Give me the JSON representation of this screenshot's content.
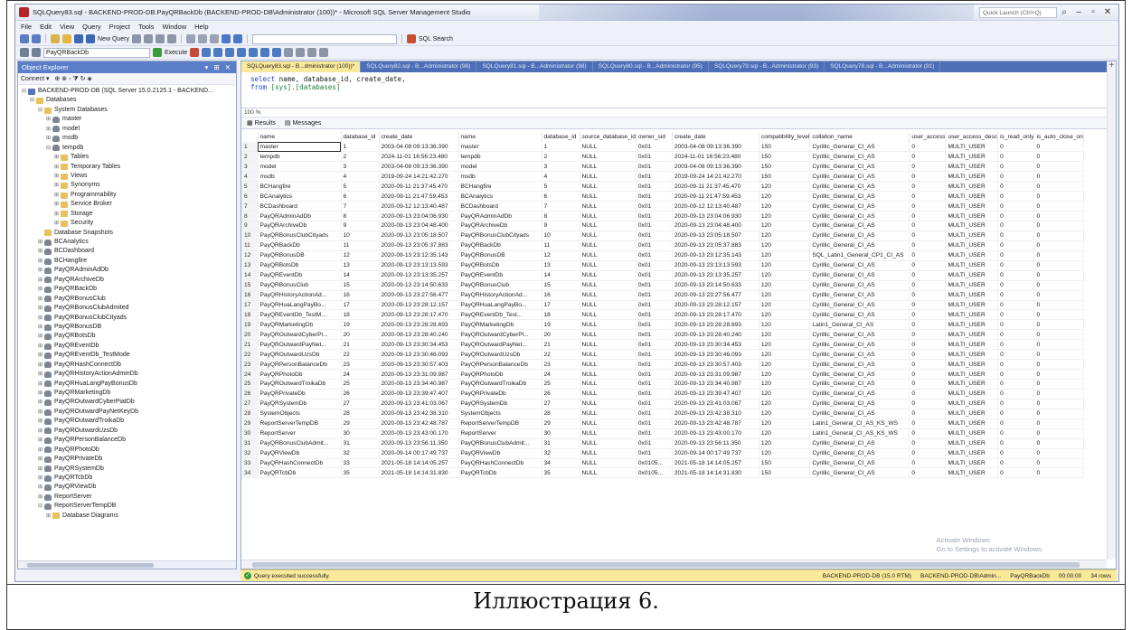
{
  "window": {
    "title": "SQLQuery83.sql - BACKEND-PROD-DB.PayQRBackDb (BACKEND-PROD-DB\\Administrator (100))* - Microsoft SQL Server Management Studio",
    "quick_launch": "Quick Launch (Ctrl+Q)"
  },
  "menu": [
    "File",
    "Edit",
    "View",
    "Query",
    "Project",
    "Tools",
    "Window",
    "Help"
  ],
  "toolbar": {
    "new_query": "New Query",
    "database": "PayQRBackDb",
    "execute": "Execute",
    "sql_search": "SQL Search"
  },
  "explorer": {
    "title": "Object Explorer",
    "connect": "Connect ▾",
    "items": [
      {
        "indent": 0,
        "toggle": "⊟",
        "icon": "server",
        "label": "BACKEND-PROD-DB (SQL Server 15.0.2125.1 - BACKEND..."
      },
      {
        "indent": 1,
        "toggle": "⊟",
        "icon": "folder",
        "label": "Databases"
      },
      {
        "indent": 2,
        "toggle": "⊟",
        "icon": "folder",
        "label": "System Databases"
      },
      {
        "indent": 3,
        "toggle": "⊞",
        "icon": "db",
        "label": "master"
      },
      {
        "indent": 3,
        "toggle": "⊞",
        "icon": "db",
        "label": "model"
      },
      {
        "indent": 3,
        "toggle": "⊞",
        "icon": "db",
        "label": "msdb"
      },
      {
        "indent": 3,
        "toggle": "⊟",
        "icon": "db",
        "label": "tempdb"
      },
      {
        "indent": 4,
        "toggle": "⊞",
        "icon": "folder",
        "label": "Tables"
      },
      {
        "indent": 4,
        "toggle": "⊞",
        "icon": "folder",
        "label": "Temporary Tables"
      },
      {
        "indent": 4,
        "toggle": "⊞",
        "icon": "folder",
        "label": "Views"
      },
      {
        "indent": 4,
        "toggle": "⊞",
        "icon": "folder",
        "label": "Synonyms"
      },
      {
        "indent": 4,
        "toggle": "⊞",
        "icon": "folder",
        "label": "Programmability"
      },
      {
        "indent": 4,
        "toggle": "⊞",
        "icon": "folder",
        "label": "Service Broker"
      },
      {
        "indent": 4,
        "toggle": "⊞",
        "icon": "folder",
        "label": "Storage"
      },
      {
        "indent": 4,
        "toggle": "⊞",
        "icon": "folder",
        "label": "Security"
      },
      {
        "indent": 2,
        "toggle": "",
        "icon": "folder",
        "label": "Database Snapshots"
      },
      {
        "indent": 2,
        "toggle": "⊞",
        "icon": "db",
        "label": "BCAnalytics"
      },
      {
        "indent": 2,
        "toggle": "⊞",
        "icon": "db",
        "label": "BCDashboard"
      },
      {
        "indent": 2,
        "toggle": "⊞",
        "icon": "db",
        "label": "BCHangfire"
      },
      {
        "indent": 2,
        "toggle": "⊞",
        "icon": "db",
        "label": "PayQRAdminAdDb"
      },
      {
        "indent": 2,
        "toggle": "⊞",
        "icon": "db",
        "label": "PayQRArchiveDb"
      },
      {
        "indent": 2,
        "toggle": "⊞",
        "icon": "db",
        "label": "PayQRBackDb"
      },
      {
        "indent": 2,
        "toggle": "⊞",
        "icon": "db",
        "label": "PayQRBonusClub"
      },
      {
        "indent": 2,
        "toggle": "⊞",
        "icon": "db",
        "label": "PayQRBonusClubAdmited"
      },
      {
        "indent": 2,
        "toggle": "⊞",
        "icon": "db",
        "label": "PayQRBonusClubCityads"
      },
      {
        "indent": 2,
        "toggle": "⊞",
        "icon": "db",
        "label": "PayQRBonusDB"
      },
      {
        "indent": 2,
        "toggle": "⊞",
        "icon": "db",
        "label": "PayQRBotsDb"
      },
      {
        "indent": 2,
        "toggle": "⊞",
        "icon": "db",
        "label": "PayQREventDb"
      },
      {
        "indent": 2,
        "toggle": "⊞",
        "icon": "db",
        "label": "PayQREventDb_TestMode"
      },
      {
        "indent": 2,
        "toggle": "⊞",
        "icon": "db",
        "label": "PayQRHashConnectDb"
      },
      {
        "indent": 2,
        "toggle": "⊞",
        "icon": "db",
        "label": "PayQRHistoryActionAdminDb"
      },
      {
        "indent": 2,
        "toggle": "⊞",
        "icon": "db",
        "label": "PayQRHuaLangPayBonusDb"
      },
      {
        "indent": 2,
        "toggle": "⊞",
        "icon": "db",
        "label": "PayQRMarketingDb"
      },
      {
        "indent": 2,
        "toggle": "⊞",
        "icon": "db",
        "label": "PayQROutwardCyberPiatDb"
      },
      {
        "indent": 2,
        "toggle": "⊞",
        "icon": "db",
        "label": "PayQROutwardPayNetKeyDb"
      },
      {
        "indent": 2,
        "toggle": "⊞",
        "icon": "db",
        "label": "PayQROutwardTroikaDb"
      },
      {
        "indent": 2,
        "toggle": "⊞",
        "icon": "db",
        "label": "PayQROutwardUzsDb"
      },
      {
        "indent": 2,
        "toggle": "⊞",
        "icon": "db",
        "label": "PayQRPersonBalanceDb"
      },
      {
        "indent": 2,
        "toggle": "⊞",
        "icon": "db",
        "label": "PayQRPhotoDb"
      },
      {
        "indent": 2,
        "toggle": "⊞",
        "icon": "db",
        "label": "PayQRPrivateDb"
      },
      {
        "indent": 2,
        "toggle": "⊞",
        "icon": "db",
        "label": "PayQRSystemDb"
      },
      {
        "indent": 2,
        "toggle": "⊞",
        "icon": "db",
        "label": "PayQRTcbDb"
      },
      {
        "indent": 2,
        "toggle": "⊞",
        "icon": "db",
        "label": "PayQRViewDb"
      },
      {
        "indent": 2,
        "toggle": "⊞",
        "icon": "db",
        "label": "ReportServer"
      },
      {
        "indent": 2,
        "toggle": "⊟",
        "icon": "db",
        "label": "ReportServerTempDB"
      },
      {
        "indent": 3,
        "toggle": "⊞",
        "icon": "folder",
        "label": "Database Diagrams"
      }
    ]
  },
  "editor": {
    "tabs": [
      "SQLQuery83.sql - B...dministrator (100))*",
      "SQLQuery82.sql - B...Administrator (98)",
      "SQLQuery81.sql - B...Administrator (98)",
      "SQLQuery80.sql - B...Administrator (95)",
      "SQLQuery79.sql - B...Administrator (93)",
      "SQLQuery78.sql - B...Administrator (91)"
    ],
    "code_line1_kw": "select",
    "code_line1_rest": " name, database_id, create_date,",
    "code_line2_kw": "from",
    "code_line2_rest": "[sys].[databases]",
    "zoom": "100 %",
    "results_tab": "Results",
    "messages_tab": "Messages"
  },
  "grid": {
    "columns": [
      "",
      "name",
      "database_id",
      "create_date",
      "name",
      "database_id",
      "source_database_id",
      "owner_sid",
      "create_date",
      "compatibility_level",
      "collation_name",
      "user_access",
      "user_access_desc",
      "is_read_only",
      "is_auto_close_on"
    ],
    "rows": [
      [
        "1",
        "master",
        "1",
        "2003-04-08 09:13:36.390",
        "master",
        "1",
        "NULL",
        "0x01",
        "2003-04-08 09:13:36.390",
        "150",
        "Cyrillic_General_CI_AS",
        "0",
        "MULTI_USER",
        "0",
        "0"
      ],
      [
        "2",
        "tempdb",
        "2",
        "2024-11-01 16:56:23.480",
        "tempdb",
        "2",
        "NULL",
        "0x01",
        "2024-11-01 16:56:23.480",
        "150",
        "Cyrillic_General_CI_AS",
        "0",
        "MULTI_USER",
        "0",
        "0"
      ],
      [
        "3",
        "model",
        "3",
        "2003-04-08 09:13:36.390",
        "model",
        "3",
        "NULL",
        "0x01",
        "2003-04-08 09:13:36.390",
        "150",
        "Cyrillic_General_CI_AS",
        "0",
        "MULTI_USER",
        "0",
        "0"
      ],
      [
        "4",
        "msdb",
        "4",
        "2019-09-24 14:21:42.270",
        "msdb",
        "4",
        "NULL",
        "0x01",
        "2019-09-24 14:21:42.270",
        "150",
        "Cyrillic_General_CI_AS",
        "0",
        "MULTI_USER",
        "0",
        "0"
      ],
      [
        "5",
        "BCHangfire",
        "5",
        "2020-09-11 21:37:45.470",
        "BCHangfire",
        "5",
        "NULL",
        "0x01",
        "2020-09-11 21:37:45.470",
        "120",
        "Cyrillic_General_CI_AS",
        "0",
        "MULTI_USER",
        "0",
        "0"
      ],
      [
        "6",
        "BCAnalytics",
        "6",
        "2020-09-11 21:47:59.453",
        "BCAnalytics",
        "6",
        "NULL",
        "0x01",
        "2020-09-11 21:47:59.453",
        "120",
        "Cyrillic_General_CI_AS",
        "0",
        "MULTI_USER",
        "0",
        "0"
      ],
      [
        "7",
        "BCDashboard",
        "7",
        "2020-09-12 12:13:40.487",
        "BCDashboard",
        "7",
        "NULL",
        "0x01",
        "2020-09-12 12:13:40.487",
        "120",
        "Cyrillic_General_CI_AS",
        "0",
        "MULTI_USER",
        "0",
        "0"
      ],
      [
        "8",
        "PayQRAdminAdDb",
        "8",
        "2020-09-13 23:04:06.930",
        "PayQRAdminAdDb",
        "8",
        "NULL",
        "0x01",
        "2020-09-13 23:04:06.930",
        "120",
        "Cyrillic_General_CI_AS",
        "0",
        "MULTI_USER",
        "0",
        "0"
      ],
      [
        "9",
        "PayQRArchiveDb",
        "9",
        "2020-09-13 23:04:48.400",
        "PayQRArchiveDb",
        "9",
        "NULL",
        "0x01",
        "2020-09-13 23:04:48.400",
        "120",
        "Cyrillic_General_CI_AS",
        "0",
        "MULTI_USER",
        "0",
        "0"
      ],
      [
        "10",
        "PayQRBonusClubCityads",
        "10",
        "2020-09-13 23:05:18.507",
        "PayQRBonusClubCityads",
        "10",
        "NULL",
        "0x01",
        "2020-09-13 23:05:18.507",
        "120",
        "Cyrillic_General_CI_AS",
        "0",
        "MULTI_USER",
        "0",
        "0"
      ],
      [
        "11",
        "PayQRBackDb",
        "11",
        "2020-09-13 23:05:37.883",
        "PayQRBackDb",
        "11",
        "NULL",
        "0x01",
        "2020-09-13 23:05:37.883",
        "120",
        "Cyrillic_General_CI_AS",
        "0",
        "MULTI_USER",
        "0",
        "0"
      ],
      [
        "12",
        "PayQRBonusDB",
        "12",
        "2020-09-13 23:12:35.143",
        "PayQRBonusDB",
        "12",
        "NULL",
        "0x01",
        "2020-09-13 23:12:35.143",
        "120",
        "SQL_Latin1_General_CP1_CI_AS",
        "0",
        "MULTI_USER",
        "0",
        "0"
      ],
      [
        "13",
        "PayQRBotsDb",
        "13",
        "2020-09-13 23:13:13.593",
        "PayQRBotsDb",
        "13",
        "NULL",
        "0x01",
        "2020-09-13 23:13:13.593",
        "120",
        "Cyrillic_General_CI_AS",
        "0",
        "MULTI_USER",
        "0",
        "0"
      ],
      [
        "14",
        "PayQREventDb",
        "14",
        "2020-09-13 23:13:35.257",
        "PayQREventDb",
        "14",
        "NULL",
        "0x01",
        "2020-09-13 23:13:35.257",
        "120",
        "Cyrillic_General_CI_AS",
        "0",
        "MULTI_USER",
        "0",
        "0"
      ],
      [
        "15",
        "PayQRBonusClub",
        "15",
        "2020-09-13 23:14:50.633",
        "PayQRBonusClub",
        "15",
        "NULL",
        "0x01",
        "2020-09-13 23:14:50.633",
        "120",
        "Cyrillic_General_CI_AS",
        "0",
        "MULTI_USER",
        "0",
        "0"
      ],
      [
        "16",
        "PayQRHistoryActionAd...",
        "16",
        "2020-09-13 23:27:56.477",
        "PayQRHistoryActionAd...",
        "16",
        "NULL",
        "0x01",
        "2020-09-13 23:27:56.477",
        "120",
        "Cyrillic_General_CI_AS",
        "0",
        "MULTI_USER",
        "0",
        "0"
      ],
      [
        "17",
        "PayQRHuaLangPayBo...",
        "17",
        "2020-09-13 23:28:12.157",
        "PayQRHuaLangPayBo...",
        "17",
        "NULL",
        "0x01",
        "2020-09-13 23:28:12.157",
        "120",
        "Cyrillic_General_CI_AS",
        "0",
        "MULTI_USER",
        "0",
        "0"
      ],
      [
        "18",
        "PayQREventDb_TestM...",
        "18",
        "2020-09-13 23:28:17.470",
        "PayQREventDb_Test...",
        "18",
        "NULL",
        "0x01",
        "2020-09-13 23:28:17.470",
        "120",
        "Cyrillic_General_CI_AS",
        "0",
        "MULTI_USER",
        "0",
        "0"
      ],
      [
        "19",
        "PayQRMarketingDb",
        "19",
        "2020-09-13 23:28:28.693",
        "PayQRMarketingDb",
        "19",
        "NULL",
        "0x01",
        "2020-09-13 23:28:28.693",
        "120",
        "Latin1_General_CI_AS",
        "0",
        "MULTI_USER",
        "0",
        "0"
      ],
      [
        "20",
        "PayQROutwardCyberPl...",
        "20",
        "2020-09-13 23:28:40.240",
        "PayQROutwardCyberPl...",
        "20",
        "NULL",
        "0x01",
        "2020-09-13 23:28:40.240",
        "120",
        "Cyrillic_General_CI_AS",
        "0",
        "MULTI_USER",
        "0",
        "0"
      ],
      [
        "21",
        "PayQROutwardPayNet...",
        "21",
        "2020-09-13 23:30:34.453",
        "PayQROutwardPayNet...",
        "21",
        "NULL",
        "0x01",
        "2020-09-13 23:30:34.453",
        "120",
        "Cyrillic_General_CI_AS",
        "0",
        "MULTI_USER",
        "0",
        "0"
      ],
      [
        "22",
        "PayQROutwardUzsDb",
        "22",
        "2020-09-13 23:30:46.093",
        "PayQROutwardUzsDb",
        "22",
        "NULL",
        "0x01",
        "2020-09-13 23:30:46.093",
        "120",
        "Cyrillic_General_CI_AS",
        "0",
        "MULTI_USER",
        "0",
        "0"
      ],
      [
        "23",
        "PayQRPersonBalanceDb",
        "23",
        "2020-09-13 23:30:57.403",
        "PayQRPersonBalanceDb",
        "23",
        "NULL",
        "0x01",
        "2020-09-13 23:30:57.403",
        "120",
        "Cyrillic_General_CI_AS",
        "0",
        "MULTI_USER",
        "0",
        "0"
      ],
      [
        "24",
        "PayQRPhotoDb",
        "24",
        "2020-09-13 23:31:09.987",
        "PayQRPhotoDb",
        "24",
        "NULL",
        "0x01",
        "2020-09-13 23:31:09.987",
        "120",
        "Cyrillic_General_CI_AS",
        "0",
        "MULTI_USER",
        "0",
        "0"
      ],
      [
        "25",
        "PayQROutwardTroikaDb",
        "25",
        "2020-09-13 23:34:40.987",
        "PayQROutwardTroikaDb",
        "25",
        "NULL",
        "0x01",
        "2020-09-13 23:34:40.987",
        "120",
        "Cyrillic_General_CI_AS",
        "0",
        "MULTI_USER",
        "0",
        "0"
      ],
      [
        "26",
        "PayQRPrivateDb",
        "26",
        "2020-09-13 23:39:47.407",
        "PayQRPrivateDb",
        "26",
        "NULL",
        "0x01",
        "2020-09-13 23:39:47.407",
        "120",
        "Cyrillic_General_CI_AS",
        "0",
        "MULTI_USER",
        "0",
        "0"
      ],
      [
        "27",
        "PayQRSystemDb",
        "27",
        "2020-09-13 23:41:03.067",
        "PayQRSystemDb",
        "27",
        "NULL",
        "0x01",
        "2020-09-13 23:41:03.067",
        "120",
        "Cyrillic_General_CI_AS",
        "0",
        "MULTI_USER",
        "0",
        "0"
      ],
      [
        "28",
        "SystemObjects",
        "28",
        "2020-09-13 23:42:38.310",
        "SystemObjects",
        "28",
        "NULL",
        "0x01",
        "2020-09-13 23:42:38.310",
        "120",
        "Cyrillic_General_CI_AS",
        "0",
        "MULTI_USER",
        "0",
        "0"
      ],
      [
        "29",
        "ReportServerTempDB",
        "29",
        "2020-09-13 23:42:48.787",
        "ReportServerTempDB",
        "29",
        "NULL",
        "0x01",
        "2020-09-13 23:42:48.787",
        "120",
        "Latin1_General_CI_AS_KS_WS",
        "0",
        "MULTI_USER",
        "0",
        "0"
      ],
      [
        "30",
        "ReportServer",
        "30",
        "2020-09-13 23:43:00.170",
        "ReportServer",
        "30",
        "NULL",
        "0x01",
        "2020-09-13 23:43:00.170",
        "120",
        "Latin1_General_CI_AS_KS_WS",
        "0",
        "MULTI_USER",
        "0",
        "0"
      ],
      [
        "31",
        "PayQRBonusClubAdmit...",
        "31",
        "2020-09-13 23:56:11.350",
        "PayQRBonusClubAdmit...",
        "31",
        "NULL",
        "0x01",
        "2020-09-13 23:56:11.350",
        "120",
        "Cyrillic_General_CI_AS",
        "0",
        "MULTI_USER",
        "0",
        "0"
      ],
      [
        "32",
        "PayQRViewDb",
        "32",
        "2020-09-14 00:17:49.737",
        "PayQRViewDb",
        "32",
        "NULL",
        "0x01",
        "2020-09-14 00:17:49.737",
        "120",
        "Cyrillic_General_CI_AS",
        "0",
        "MULTI_USER",
        "0",
        "0"
      ],
      [
        "33",
        "PayQRHashConnectDb",
        "33",
        "2021-05-18 14:14:05.257",
        "PayQRHashConnectDb",
        "34",
        "NULL",
        "0x0105...",
        "2021-05-18 14:14:05.257",
        "150",
        "Cyrillic_General_CI_AS",
        "0",
        "MULTI_USER",
        "0",
        "0"
      ],
      [
        "34",
        "PayQRTcbDb",
        "35",
        "2021-05-18 14:14:31.830",
        "PayQRTcbDb",
        "35",
        "NULL",
        "0x0105...",
        "2021-05-18 14:14:31.830",
        "150",
        "Cyrillic_General_CI_AS",
        "0",
        "MULTI_USER",
        "0",
        "0"
      ]
    ]
  },
  "watermark": {
    "line1": "Activate Windows",
    "line2": "Go to Settings to activate Windows."
  },
  "status": {
    "message": "Query executed successfully.",
    "server": "BACKEND-PROD-DB (15.0 RTM)",
    "user": "BACKEND-PROD-DB\\Admin...",
    "database": "PayQRBackDb",
    "elapsed": "00:00:00",
    "rows": "34 rows"
  },
  "caption": "Иллюстрация 6."
}
